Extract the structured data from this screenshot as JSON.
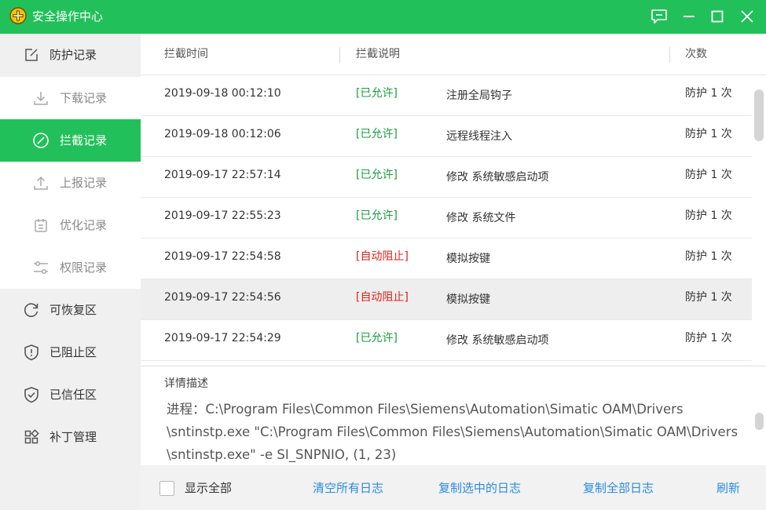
{
  "titlebar": {
    "title": "安全操作中心"
  },
  "sidebar": {
    "items": [
      {
        "label": "防护记录"
      },
      {
        "label": "下载记录"
      },
      {
        "label": "拦截记录"
      },
      {
        "label": "上报记录"
      },
      {
        "label": "优化记录"
      },
      {
        "label": "权限记录"
      },
      {
        "label": "可恢复区"
      },
      {
        "label": "已阻止区"
      },
      {
        "label": "已信任区"
      },
      {
        "label": "补丁管理"
      }
    ],
    "active": "拦截记录"
  },
  "table": {
    "headers": {
      "time": "拦截时间",
      "desc": "拦截说明",
      "count": "次数"
    },
    "rows": [
      {
        "time": "2019-09-18 00:12:10",
        "status": "[已允许]",
        "desc": "注册全局钩子",
        "count": "防护 1 次"
      },
      {
        "time": "2019-09-18 00:12:06",
        "status": "[已允许]",
        "desc": "远程线程注入",
        "count": "防护 1 次"
      },
      {
        "time": "2019-09-17 22:57:14",
        "status": "[已允许]",
        "desc": "修改 系统敏感启动项",
        "count": "防护 1 次"
      },
      {
        "time": "2019-09-17 22:55:23",
        "status": "[已允许]",
        "desc": "修改 系统文件",
        "count": "防护 1 次"
      },
      {
        "time": "2019-09-17 22:54:58",
        "status": "[自动阻止]",
        "desc": "模拟按键",
        "count": "防护 1 次"
      },
      {
        "time": "2019-09-17 22:54:56",
        "status": "[自动阻止]",
        "desc": "模拟按键",
        "count": "防护 1 次"
      },
      {
        "time": "2019-09-17 22:54:29",
        "status": "[已允许]",
        "desc": "修改 系统敏感启动项",
        "count": "防护 1 次"
      }
    ]
  },
  "details": {
    "title": "详情描述",
    "lines": [
      "进程：C:\\Program Files\\Common Files\\Siemens\\Automation\\Simatic OAM\\Drivers",
      "\\sntinstp.exe \"C:\\Program Files\\Common Files\\Siemens\\Automation\\Simatic OAM\\Drivers",
      "\\sntinstp.exe\" -e SI_SNPNIO, (1, 23)"
    ]
  },
  "footer": {
    "show_all_label": "显示全部",
    "clear_logs": "清空所有日志",
    "copy_selected": "复制选中的日志",
    "copy_all": "复制全部日志",
    "refresh": "刷新"
  },
  "colors": {
    "brand_green": "#22c05a",
    "allowed_green": "#1a9e3e",
    "blocked_red": "#d9251c",
    "link_blue": "#2b8be0"
  }
}
